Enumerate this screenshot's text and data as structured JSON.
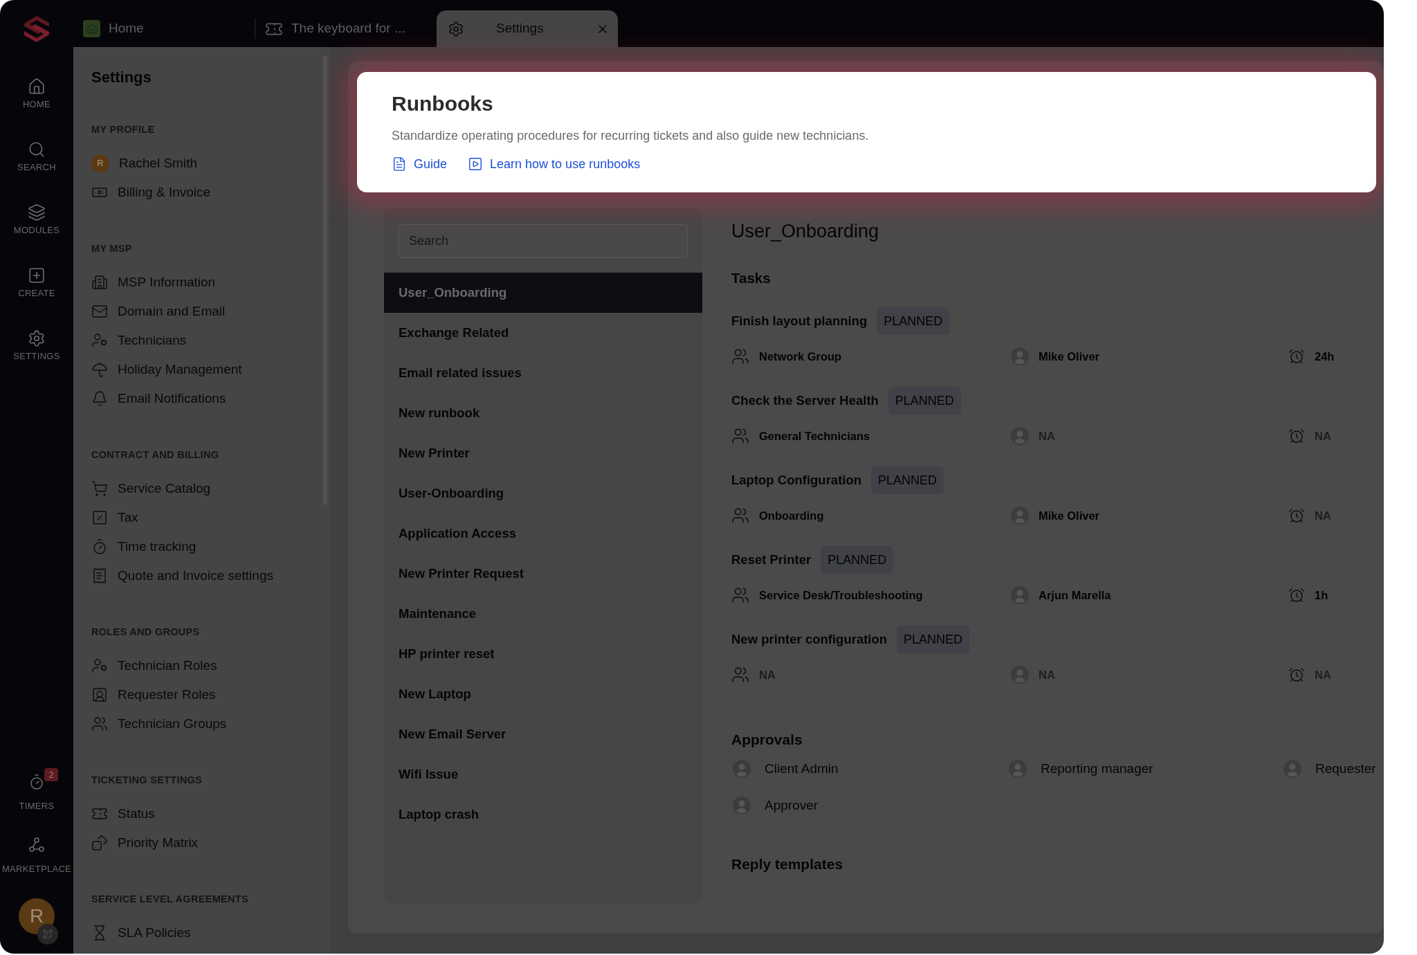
{
  "rail": {
    "items": [
      {
        "label": "HOME"
      },
      {
        "label": "SEARCH"
      },
      {
        "label": "MODULES"
      },
      {
        "label": "CREATE"
      },
      {
        "label": "SETTINGS"
      }
    ],
    "bottom_items": [
      {
        "label": "TIMERS",
        "badge": "2"
      },
      {
        "label": "MARKETPLACE"
      }
    ],
    "avatar_initial": "R"
  },
  "tabs": [
    {
      "label": "Home",
      "selected": false
    },
    {
      "label": "The keyboard for ...",
      "selected": false
    },
    {
      "label": "Settings",
      "selected": true
    }
  ],
  "settings_nav": {
    "title": "Settings",
    "sections": [
      {
        "heading": "MY PROFILE",
        "items": [
          {
            "label": "Rachel Smith",
            "kind": "profile",
            "avatar_initial": "R"
          },
          {
            "label": "Billing & Invoice",
            "kind": "page"
          }
        ]
      },
      {
        "heading": "MY MSP",
        "items": [
          {
            "label": "MSP Information",
            "kind": "page"
          },
          {
            "label": "Domain and Email",
            "kind": "page"
          },
          {
            "label": "Technicians",
            "kind": "page"
          },
          {
            "label": "Holiday Management",
            "kind": "page"
          },
          {
            "label": "Email Notifications",
            "kind": "page"
          }
        ]
      },
      {
        "heading": "CONTRACT AND BILLING",
        "items": [
          {
            "label": "Service Catalog",
            "kind": "page"
          },
          {
            "label": "Tax",
            "kind": "page"
          },
          {
            "label": "Time tracking",
            "kind": "page"
          },
          {
            "label": "Quote and Invoice settings",
            "kind": "page"
          }
        ]
      },
      {
        "heading": "ROLES AND GROUPS",
        "items": [
          {
            "label": "Technician Roles",
            "kind": "page"
          },
          {
            "label": "Requester Roles",
            "kind": "page"
          },
          {
            "label": "Technician Groups",
            "kind": "page"
          }
        ]
      },
      {
        "heading": "TICKETING SETTINGS",
        "items": [
          {
            "label": "Status",
            "kind": "page"
          },
          {
            "label": "Priority Matrix",
            "kind": "page"
          }
        ]
      },
      {
        "heading": "SERVICE LEVEL AGREEMENTS",
        "items": [
          {
            "label": "SLA Policies",
            "kind": "page"
          }
        ]
      }
    ]
  },
  "runbooks_list": {
    "search": {
      "placeholder": "Search"
    },
    "items": [
      {
        "label": "User_Onboarding",
        "selected": true
      },
      {
        "label": "Exchange Related",
        "selected": false
      },
      {
        "label": "Email related issues",
        "selected": false
      },
      {
        "label": "New runbook",
        "selected": false
      },
      {
        "label": "New Printer",
        "selected": false
      },
      {
        "label": "User-Onboarding",
        "selected": false
      },
      {
        "label": "Application Access",
        "selected": false
      },
      {
        "label": "New Printer Request",
        "selected": false
      },
      {
        "label": "Maintenance",
        "selected": false
      },
      {
        "label": "HP printer reset",
        "selected": false
      },
      {
        "label": "New Laptop",
        "selected": false
      },
      {
        "label": "New Email Server",
        "selected": false
      },
      {
        "label": "Wifi Issue",
        "selected": false
      },
      {
        "label": "Laptop crash",
        "selected": false
      }
    ]
  },
  "runbook_detail": {
    "title": "User_Onboarding",
    "tasks_heading": "Tasks",
    "tasks": [
      {
        "title": "Finish layout planning",
        "status": "PLANNED",
        "group": {
          "text": "Network Group",
          "muted": false
        },
        "assignee": {
          "text": "Mike Oliver",
          "muted": false
        },
        "duration": {
          "text": "24h",
          "muted": false
        }
      },
      {
        "title": "Check the Server Health",
        "status": "PLANNED",
        "group": {
          "text": "General Technicians",
          "muted": false
        },
        "assignee": {
          "text": "NA",
          "muted": true
        },
        "duration": {
          "text": "NA",
          "muted": true
        }
      },
      {
        "title": "Laptop Configuration",
        "status": "PLANNED",
        "group": {
          "text": "Onboarding",
          "muted": false
        },
        "assignee": {
          "text": "Mike Oliver",
          "muted": false
        },
        "duration": {
          "text": "NA",
          "muted": true
        }
      },
      {
        "title": "Reset Printer",
        "status": "PLANNED",
        "group": {
          "text": "Service Desk/Troubleshooting",
          "muted": false
        },
        "assignee": {
          "text": "Arjun Marella",
          "muted": false
        },
        "duration": {
          "text": "1h",
          "muted": false
        }
      },
      {
        "title": "New printer configuration",
        "status": "PLANNED",
        "group": {
          "text": "NA",
          "muted": true
        },
        "assignee": {
          "text": "NA",
          "muted": true
        },
        "duration": {
          "text": "NA",
          "muted": true
        }
      }
    ],
    "approvals_heading": "Approvals",
    "approvers": [
      "Client Admin",
      "Reporting manager",
      "Requester",
      "Approver"
    ],
    "next_heading": "Reply templates"
  },
  "tour_popup": {
    "title": "Runbooks",
    "description": "Standardize operating procedures for recurring tickets and also guide new technicians.",
    "links": [
      {
        "label": "Guide",
        "kind": "document"
      },
      {
        "label": "Learn how to use runbooks",
        "kind": "video"
      }
    ]
  }
}
